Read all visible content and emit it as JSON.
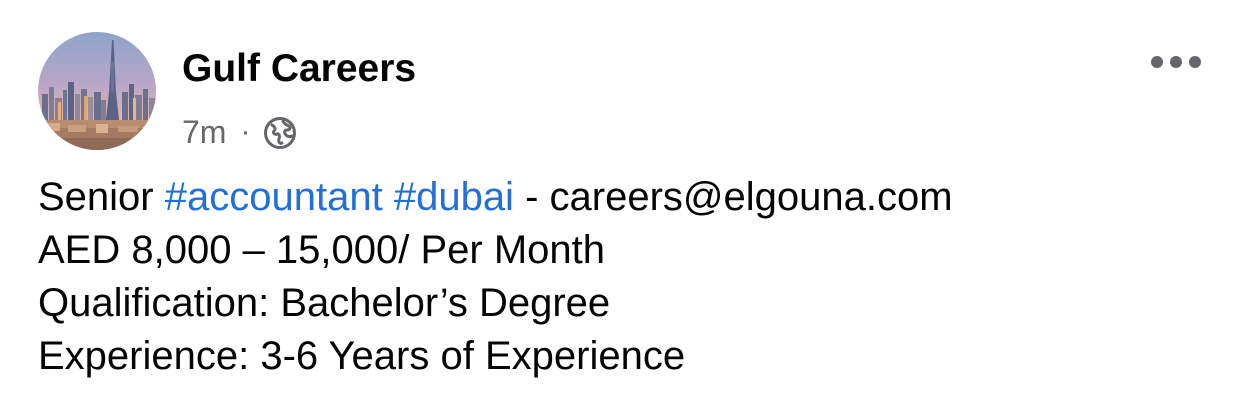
{
  "post": {
    "author": "Gulf Careers",
    "time": "7m",
    "separator": "·",
    "privacy_icon": "globe-icon",
    "more_icon": "more-options-icon",
    "body": {
      "line1": {
        "prefix": "Senior",
        "hashtag1": "#accountant",
        "hashtag2": "#dubai",
        "suffix": "- careers@elgouna.com"
      },
      "line2": "AED 8,000 – 15,000/ Per Month",
      "line3": "Qualification: Bachelor’s Degree",
      "line4": "Experience: 3-6 Years of Experience"
    }
  },
  "colors": {
    "text": "#050505",
    "secondary": "#65676b",
    "hashtag": "#216fdb",
    "background": "#ffffff"
  }
}
